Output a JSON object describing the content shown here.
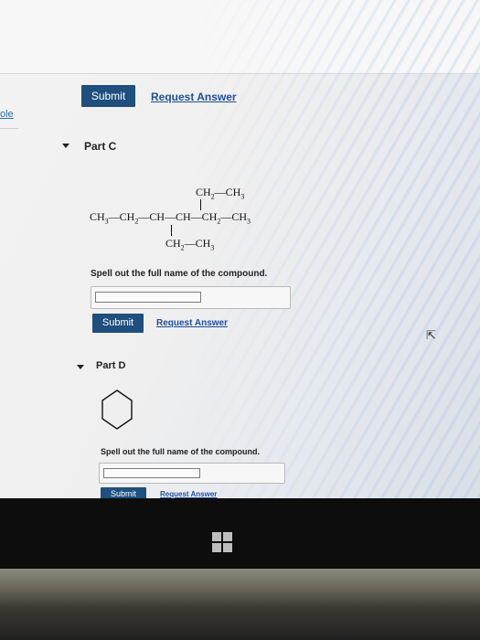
{
  "top": {
    "submit_label": "Submit",
    "request_answer_label": "Request Answer",
    "side_link": "ole"
  },
  "part_c": {
    "label": "Part C",
    "structure": {
      "top_branch": "CH2—CH3",
      "main_chain": "CH3—CH2—CH—CH—CH2—CH3",
      "bottom_branch": "CH2—CH3"
    },
    "prompt": "Spell out the full name of the compound.",
    "answer_value": "",
    "submit_label": "Submit",
    "request_answer_label": "Request Answer"
  },
  "part_d": {
    "label": "Part D",
    "prompt": "Spell out the full name of the compound.",
    "answer_value": "",
    "submit_label": "Submit",
    "request_answer_label": "Request Answer"
  },
  "colors": {
    "button": "#1f4f7d",
    "link": "#1f4f9a"
  }
}
